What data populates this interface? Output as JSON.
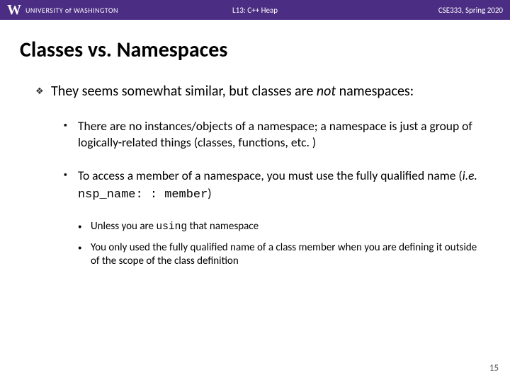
{
  "header": {
    "logo": "W",
    "university": "UNIVERSITY of WASHINGTON",
    "lecture": "L13: C++ Heap",
    "course": "CSE333, Spring 2020"
  },
  "title": "Classes vs. Namespaces",
  "bullets": {
    "main": {
      "pre": "They seems somewhat similar, but classes are ",
      "not": "not",
      "post": " namespaces:"
    },
    "sub1": "There are no instances/objects of a namespace; a namespace is just a group of logically-related things (classes, functions, etc. )",
    "sub2": {
      "pre": "To access a member of a namespace, you must use the fully qualified name (",
      "ie": "i.e.",
      "code": " nsp_name: : member",
      "post": ")"
    },
    "ssub1": {
      "pre": "Unless you are ",
      "code": "using",
      "post": " that namespace"
    },
    "ssub2": "You only used the fully qualified name of a class member when you are defining it outside of the scope of the class definition"
  },
  "glyphs": {
    "diamond": "❖",
    "square": "▪",
    "dot": "•"
  },
  "page": "15"
}
